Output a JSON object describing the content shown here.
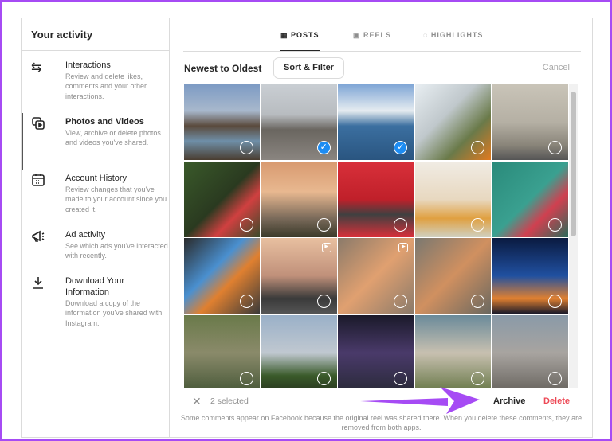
{
  "sidebar": {
    "title": "Your activity",
    "items": [
      {
        "label": "Interactions",
        "desc": "Review and delete likes, comments and your other interactions.",
        "icon": "arrows-swap-icon"
      },
      {
        "label": "Photos and Videos",
        "desc": "View, archive or delete photos and videos you've shared.",
        "icon": "photos-videos-icon",
        "active": true
      },
      {
        "label": "Account History",
        "desc": "Review changes that you've made to your account since you created it.",
        "icon": "calendar-icon"
      },
      {
        "label": "Ad activity",
        "desc": "See which ads you've interacted with recently.",
        "icon": "megaphone-icon"
      },
      {
        "label": "Download Your Information",
        "desc": "Download a copy of the information you've shared with Instagram.",
        "icon": "download-icon"
      }
    ]
  },
  "tabs": [
    {
      "label": "POSTS",
      "icon": "grid-icon"
    },
    {
      "label": "REELS",
      "icon": "reels-icon"
    },
    {
      "label": "HIGHLIGHTS",
      "icon": "highlights-icon"
    }
  ],
  "sort": {
    "label": "Newest to Oldest",
    "button": "Sort & Filter",
    "cancel": "Cancel"
  },
  "tiles": [
    {
      "selected": false,
      "reel": false
    },
    {
      "selected": true,
      "reel": false
    },
    {
      "selected": true,
      "reel": false
    },
    {
      "selected": false,
      "reel": false
    },
    {
      "selected": false,
      "reel": false
    },
    {
      "selected": false,
      "reel": false
    },
    {
      "selected": false,
      "reel": false
    },
    {
      "selected": false,
      "reel": false
    },
    {
      "selected": false,
      "reel": false
    },
    {
      "selected": false,
      "reel": false
    },
    {
      "selected": false,
      "reel": false
    },
    {
      "selected": false,
      "reel": true
    },
    {
      "selected": false,
      "reel": true
    },
    {
      "selected": false,
      "reel": false
    },
    {
      "selected": false,
      "reel": false
    },
    {
      "selected": false,
      "reel": false
    },
    {
      "selected": false,
      "reel": false
    },
    {
      "selected": false,
      "reel": false
    },
    {
      "selected": false,
      "reel": false
    },
    {
      "selected": false,
      "reel": false
    }
  ],
  "footer": {
    "selected": "2 selected",
    "archive": "Archive",
    "delete": "Delete",
    "note": "Some comments appear on Facebook because the original reel was shared there. When you delete these comments, they are removed from both apps."
  },
  "colors": {
    "accent": "#1d8cf2",
    "delete": "#ed4956",
    "arrow": "#a64bf4"
  }
}
